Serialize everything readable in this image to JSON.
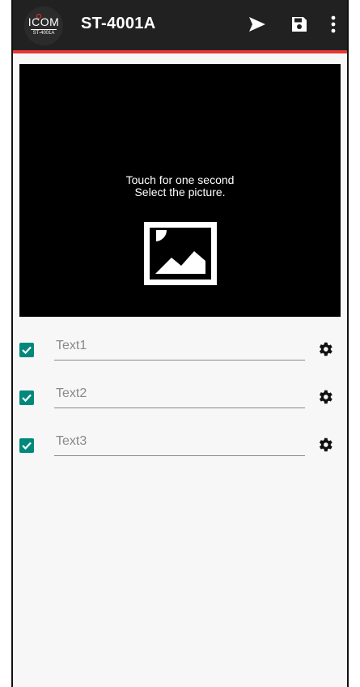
{
  "appbar": {
    "title": "ST-4001A",
    "logo_brand": "ICOM",
    "logo_model": "ST-4001A",
    "actions": [
      "send-icon",
      "save-icon",
      "more-vert-icon"
    ]
  },
  "picture": {
    "hint_line1": "Touch for one second",
    "hint_line2": "Select the picture.",
    "icon": "image-icon"
  },
  "text_rows": [
    {
      "checked": true,
      "value": "Text1"
    },
    {
      "checked": true,
      "value": "Text2"
    },
    {
      "checked": true,
      "value": "Text3"
    }
  ],
  "colors": {
    "appbar": "#212121",
    "accent_line": "#e53935",
    "checkbox": "#00897b",
    "background": "#f7f7f7"
  }
}
